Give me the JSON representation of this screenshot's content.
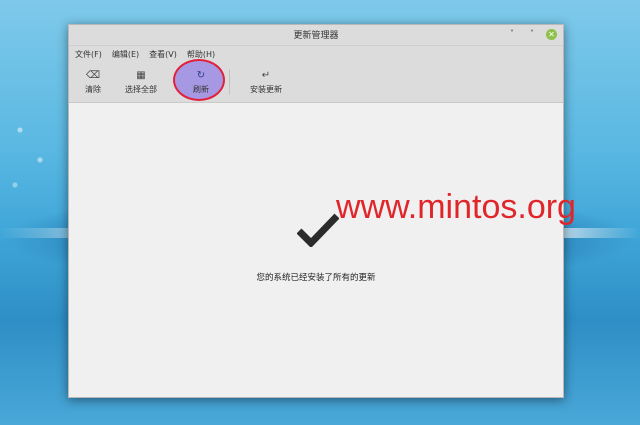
{
  "window": {
    "title": "更新管理器",
    "controls": {
      "minimize": "˅",
      "restore": "˄",
      "close": "✕"
    }
  },
  "menu": [
    "文件(F)",
    "编辑(E)",
    "查看(V)",
    "帮助(H)"
  ],
  "toolbar": {
    "clear": {
      "label": "清除",
      "icon": "⌫"
    },
    "select_all": {
      "label": "选择全部",
      "icon": "▦"
    },
    "refresh": {
      "label": "刷新",
      "icon": "↻"
    },
    "install": {
      "label": "安装更新",
      "icon": "↵"
    }
  },
  "status": {
    "message": "您的系统已经安装了所有的更新",
    "icon": "checkmark-icon"
  },
  "watermark": {
    "text": "www.mintos.org",
    "color": "#e0262b"
  },
  "colors": {
    "highlight_fill": "#9682e6",
    "highlight_border": "#e0223b",
    "close_button": "#8fc04a"
  }
}
